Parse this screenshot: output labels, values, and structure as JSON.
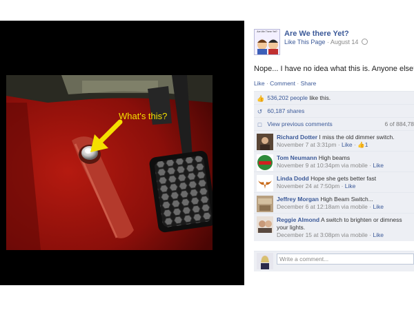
{
  "photo": {
    "caption": "What's this?"
  },
  "page": {
    "avatar_text": "Are We There Yet?",
    "name": "Are We there Yet?",
    "like_page": "Like This Page",
    "date": "August 14"
  },
  "post": {
    "text": "Nope... I have no idea what this is. Anyone else?",
    "actions": [
      "Like",
      "Comment",
      "Share"
    ]
  },
  "stats": {
    "likes_count": "536,202 people",
    "likes_suffix": "like this.",
    "shares": "60,187 shares",
    "view_previous": "View previous comments",
    "pagination": "6 of 884,78"
  },
  "comments": [
    {
      "author": "Richard Dotter",
      "text": "I miss the old dimmer switch.",
      "time": "November 7 at 3:31pm",
      "extra": "Like",
      "likes": "1"
    },
    {
      "author": "Tom Neumann",
      "text": "High beams",
      "time": "November 9 at 10:34pm via mobile",
      "extra": "Like"
    },
    {
      "author": "Linda Dodd",
      "text": "Hope she gets better fast",
      "time": "November 24 at 7:50pm",
      "extra": "Like"
    },
    {
      "author": "Jeffrey Morgan",
      "text": "High Beam Switch...",
      "time": "December 6 at 12:18am via mobile",
      "extra": "Like"
    },
    {
      "author": "Reggie Almond",
      "text": "A switch to brighten or dimness your lights.",
      "time": "December 15 at 3:08pm via mobile",
      "extra": "Like"
    }
  ],
  "composer": {
    "placeholder": "Write a comment..."
  },
  "colors": {
    "link": "#3b5998",
    "panel": "#edeff4",
    "carpet": "#8a0f0a",
    "arrow": "#f5e000"
  }
}
